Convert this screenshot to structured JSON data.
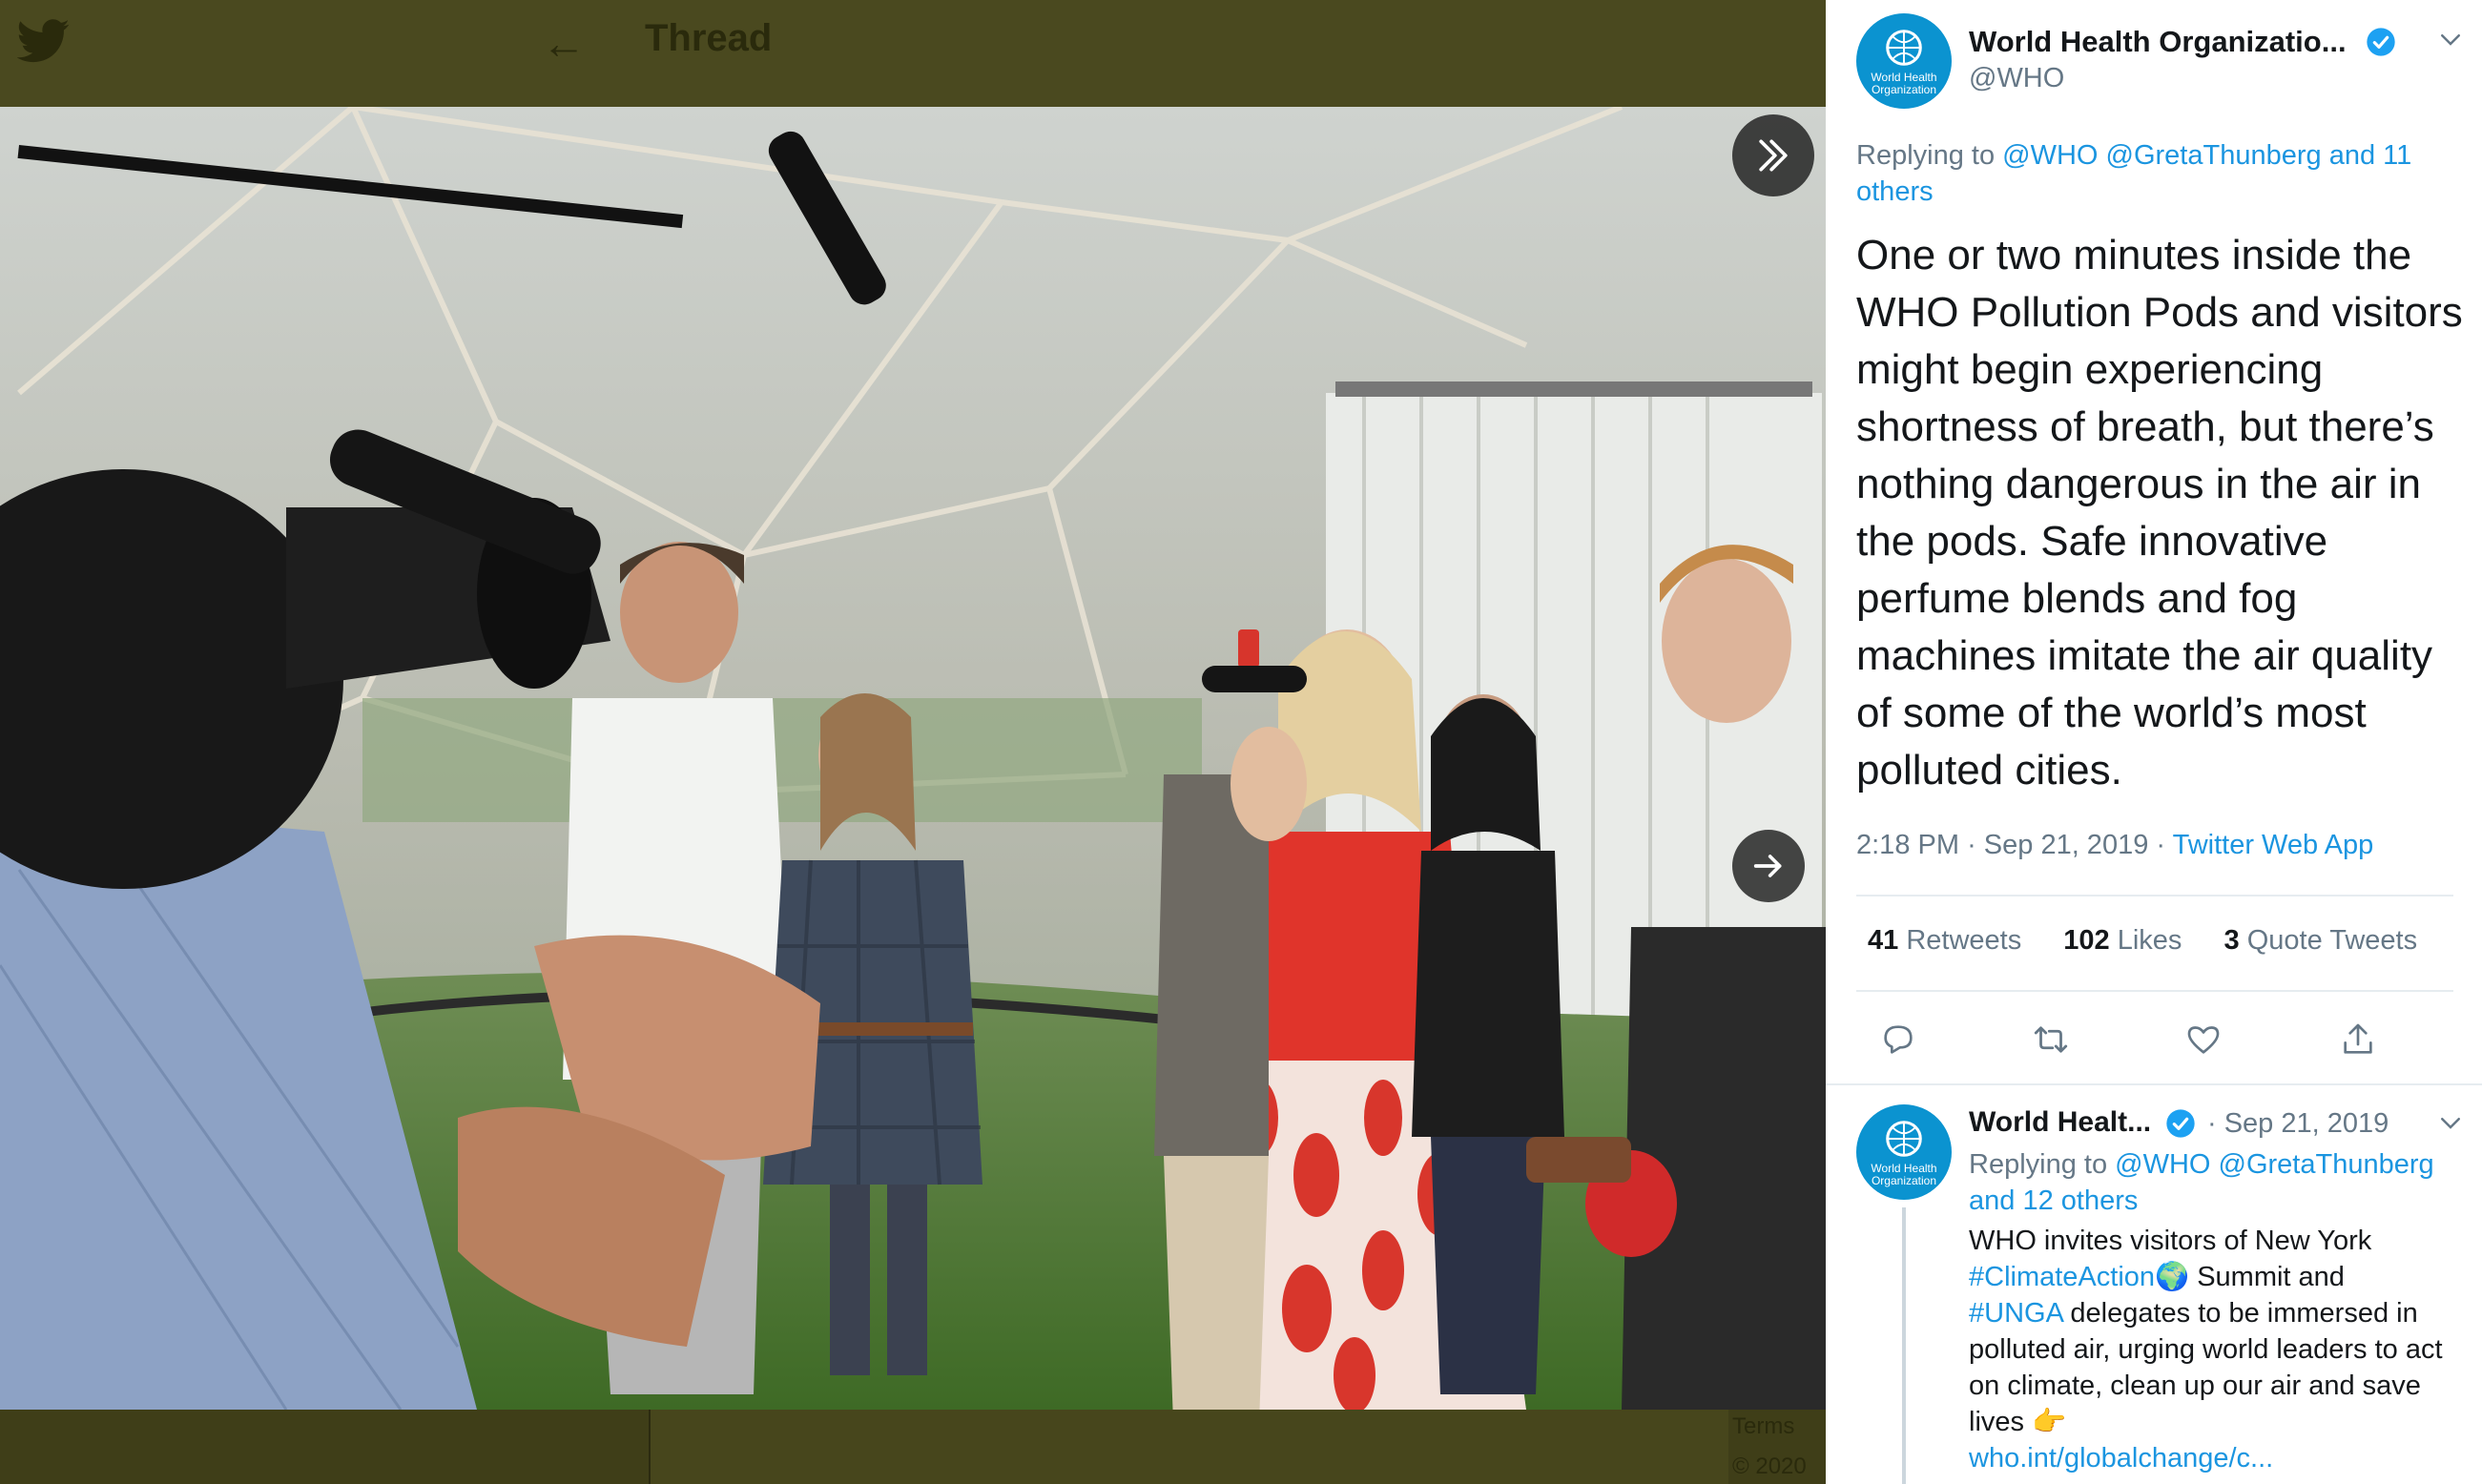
{
  "background_page": {
    "header_title": "Thread",
    "footer_terms": "Terms",
    "footer_year": "© 2020"
  },
  "photo": {
    "collapse_icon": "double-chevron-right-icon",
    "next_icon": "arrow-right-icon"
  },
  "main_tweet": {
    "author_name": "World Health Organizatio...",
    "handle": "@WHO",
    "avatar_label": "World Health Organization",
    "replying_prefix": "Replying to",
    "replying_links": "@WHO @GretaThunberg and 11 others",
    "text": "One or two minutes inside the WHO Pollution Pods and visitors might begin experiencing shortness of breath, but there’s nothing dangerous in the air in the pods. Safe innovative perfume blends and fog machines imitate the air quality of some of the world’s most polluted cities.",
    "time": "2:18 PM",
    "date": "Sep 21, 2019",
    "source": "Twitter Web App",
    "retweets_count": "41",
    "retweets_label": "Retweets",
    "likes_count": "102",
    "likes_label": "Likes",
    "quotes_count": "3",
    "quotes_label": "Quote Tweets"
  },
  "reply_tweet": {
    "author_name": "World Healt...",
    "date": "· Sep 21, 2019",
    "avatar_label": "World Health Organization",
    "replying_prefix": "Replying to",
    "replying_links": "@WHO @GretaThunberg and 12 others",
    "line1": "WHO invites visitors of New York",
    "hashtag1": "#ClimateAction",
    "line2_rest": " Summit and",
    "hashtag2": "#UNGA",
    "line3_rest": " delegates to be immersed in polluted air, urging world leaders to act on climate, clean up our air and save lives",
    "link": "who.int/globalchange/c..."
  },
  "colors": {
    "link": "#1b95e0",
    "text": "#14171a",
    "muted": "#657786",
    "avatar": "#0b93d0",
    "verified": "#1da1f2"
  }
}
